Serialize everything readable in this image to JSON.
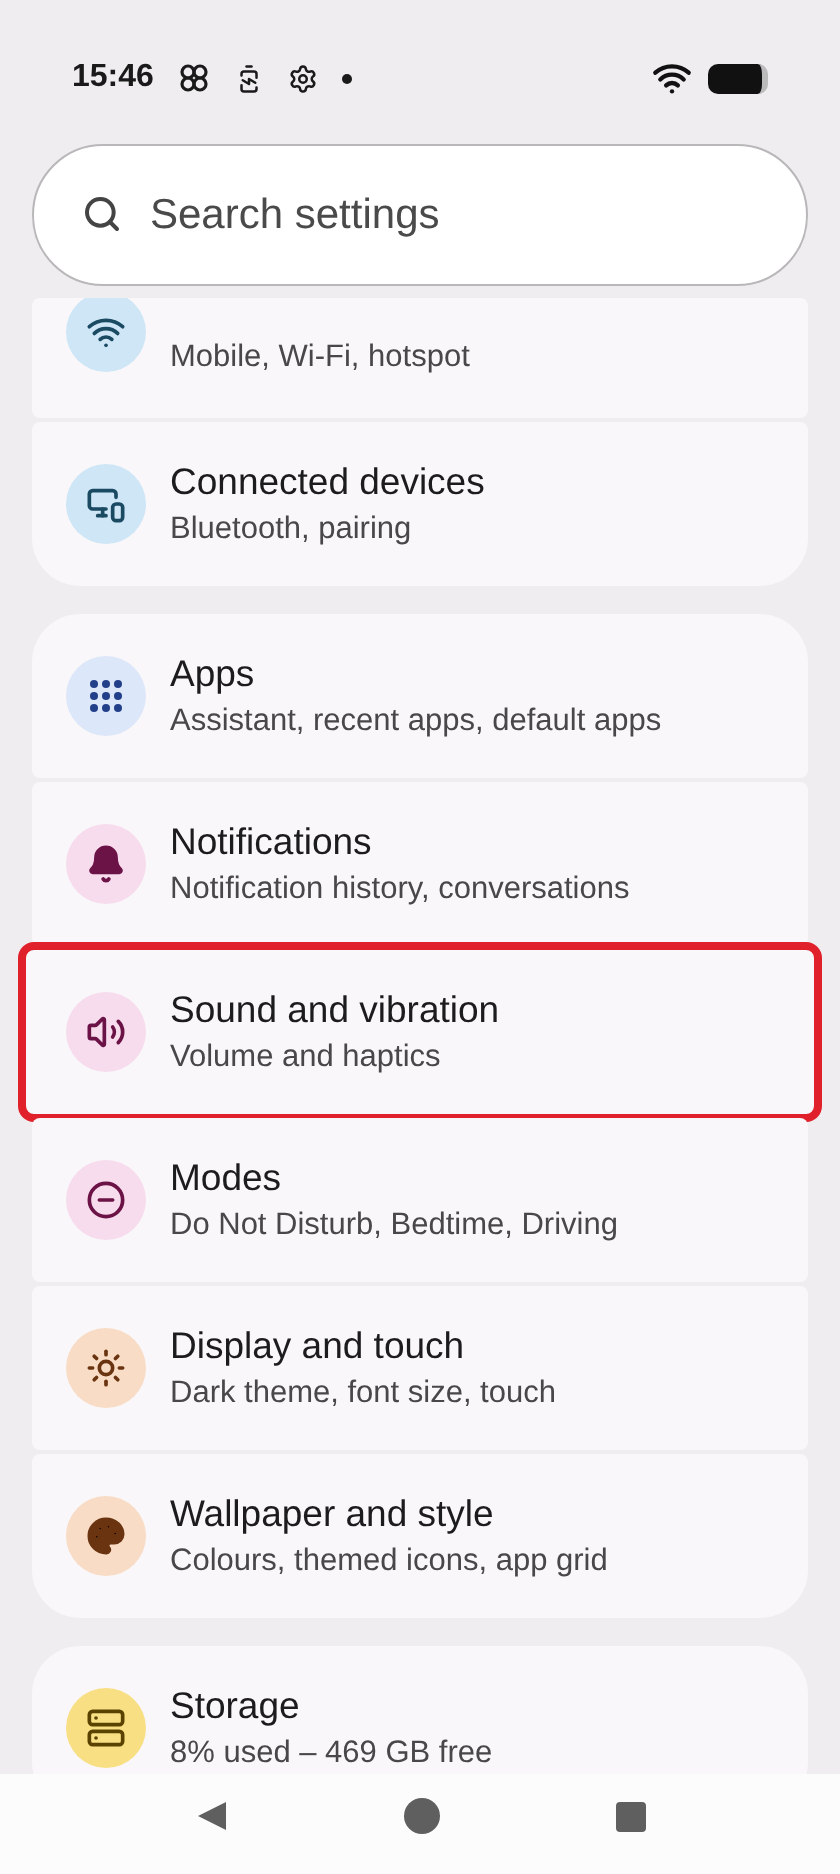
{
  "status_bar": {
    "time": "15:46"
  },
  "search": {
    "placeholder": "Search settings"
  },
  "groups": [
    {
      "items": [
        {
          "subtitle": "Mobile, Wi-Fi, hotspot",
          "color": "#cfe6f6",
          "partial": true,
          "highlighted": false
        },
        {
          "title": "Connected devices",
          "subtitle": "Bluetooth, pairing",
          "color": "#cfe6f6",
          "highlighted": false
        }
      ]
    },
    {
      "items": [
        {
          "title": "Apps",
          "subtitle": "Assistant, recent apps, default apps",
          "color": "#dde7fa",
          "highlighted": false
        },
        {
          "title": "Notifications",
          "subtitle": "Notification history, conversations",
          "color": "#f7dcee",
          "highlighted": false
        },
        {
          "title": "Sound and vibration",
          "subtitle": "Volume and haptics",
          "color": "#f7dcee",
          "highlighted": true
        },
        {
          "title": "Modes",
          "subtitle": "Do Not Disturb, Bedtime, Driving",
          "color": "#f7dcee",
          "highlighted": false
        },
        {
          "title": "Display and touch",
          "subtitle": "Dark theme, font size, touch",
          "color": "#f8dcc6",
          "highlighted": false
        },
        {
          "title": "Wallpaper and style",
          "subtitle": "Colours, themed icons, app grid",
          "color": "#f8dcc6",
          "highlighted": false
        }
      ]
    },
    {
      "items": [
        {
          "title": "Storage",
          "subtitle": "8% used – 469 GB free",
          "color": "#f8df84",
          "highlighted": false
        }
      ]
    }
  ]
}
